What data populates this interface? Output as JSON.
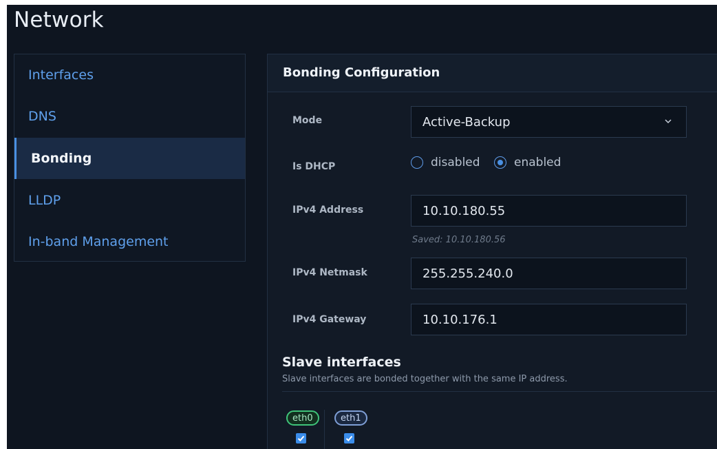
{
  "page": {
    "title": "Network"
  },
  "sidebar": {
    "items": [
      {
        "label": "Interfaces",
        "active": false
      },
      {
        "label": "DNS",
        "active": false
      },
      {
        "label": "Bonding",
        "active": true
      },
      {
        "label": "LLDP",
        "active": false
      },
      {
        "label": "In-band Management",
        "active": false
      }
    ]
  },
  "bonding": {
    "title": "Bonding Configuration",
    "mode": {
      "label": "Mode",
      "value": "Active-Backup"
    },
    "dhcp": {
      "label": "Is DHCP",
      "options": [
        "disabled",
        "enabled"
      ],
      "selected": "enabled"
    },
    "ipv4_address": {
      "label": "IPv4 Address",
      "value": "10.10.180.55",
      "saved": "Saved: 10.10.180.56"
    },
    "ipv4_netmask": {
      "label": "IPv4 Netmask",
      "value": "255.255.240.0"
    },
    "ipv4_gateway": {
      "label": "IPv4 Gateway",
      "value": "10.10.176.1"
    }
  },
  "slaves": {
    "title": "Slave interfaces",
    "description": "Slave interfaces are bonded together with the same IP address.",
    "interfaces": [
      {
        "name": "eth0",
        "checked": true,
        "color": "#3fc47a"
      },
      {
        "name": "eth1",
        "checked": true,
        "color": "#7f9fd6"
      }
    ]
  },
  "colors": {
    "accent": "#4a90e2",
    "link": "#5fa0ec",
    "background": "#0e1520"
  }
}
